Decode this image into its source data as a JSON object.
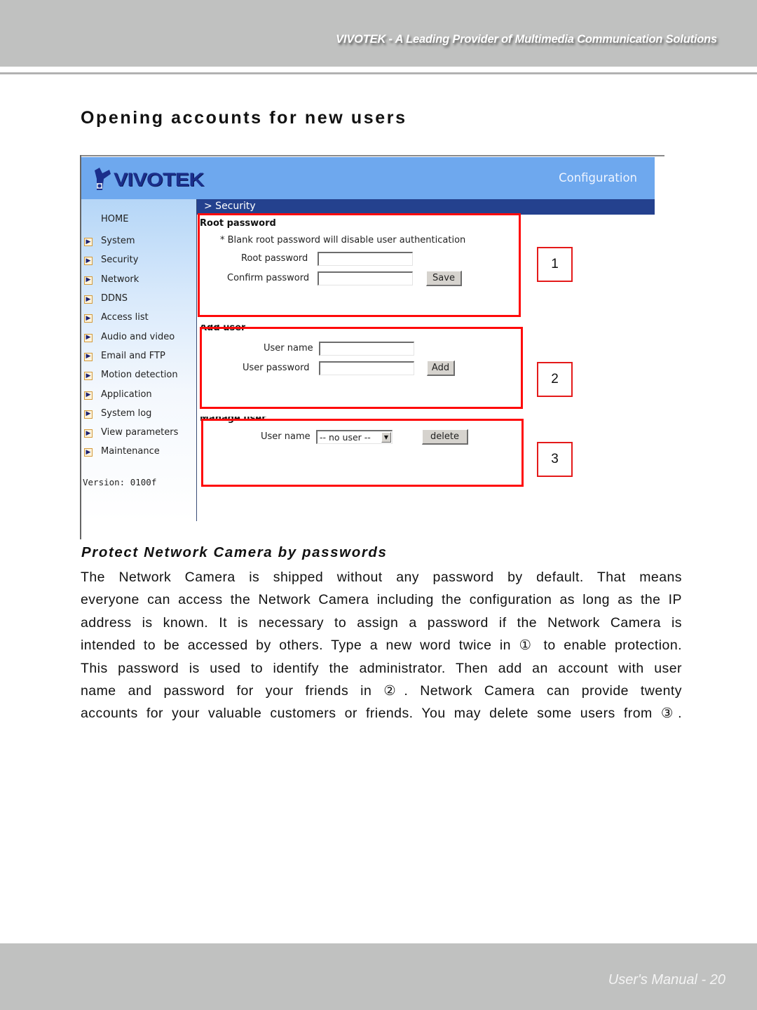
{
  "header": {
    "tagline": "VIVOTEK - A Leading Provider of Multimedia Communication Solutions"
  },
  "section_title": "Opening accounts for new users",
  "screenshot": {
    "logo_text": "VIVOTEK",
    "banner_label": "Configuration",
    "breadcrumb": "> Security",
    "sidebar": {
      "home_label": "HOME",
      "items": [
        {
          "label": "System"
        },
        {
          "label": "Security"
        },
        {
          "label": "Network"
        },
        {
          "label": "DDNS"
        },
        {
          "label": "Access list"
        },
        {
          "label": "Audio and video"
        },
        {
          "label": "Email and FTP"
        },
        {
          "label": "Motion detection"
        },
        {
          "label": "Application"
        },
        {
          "label": "System log"
        },
        {
          "label": "View parameters"
        },
        {
          "label": "Maintenance"
        }
      ],
      "version": "Version: 0100f"
    },
    "root_password": {
      "title": "Root password",
      "note": "* Blank root password will disable user authentication",
      "root_password_label": "Root password",
      "root_password_value": "",
      "confirm_password_label": "Confirm password",
      "confirm_password_value": "",
      "save_label": "Save"
    },
    "add_user": {
      "title": "Add user",
      "user_name_label": "User name",
      "user_name_value": "",
      "user_password_label": "User password",
      "user_password_value": "",
      "add_label": "Add"
    },
    "manage_user": {
      "title": "Manage user",
      "user_name_label": "User name",
      "selected_user": "-- no user --",
      "delete_label": "delete"
    },
    "callouts": [
      "1",
      "2",
      "3"
    ]
  },
  "subheading": "Protect Network Camera by passwords",
  "body_lines": [
    "The Network Camera is shipped without any password by default. That means",
    "everyone can access the Network Camera including the configuration as long as the IP",
    "address is known. It is necessary to assign a password if the Network Camera is",
    "intended to be accessed by others. Type a new word twice in ① to enable protection.",
    "This password is used to identify the administrator. Then add an account with user",
    "name and password for your friends in ②. Network Camera can provide twenty",
    "accounts for your valuable customers or friends. You may delete some users from ③."
  ],
  "footer": {
    "page_label": "User's Manual - 20"
  },
  "colors": {
    "band_gray": "#c0c1c0",
    "banner_blue": "#6ea8ee",
    "breadcrumb_navy": "#24418e",
    "highlight_red": "#ff0a0a",
    "logo_navy": "#1b2f8c"
  }
}
